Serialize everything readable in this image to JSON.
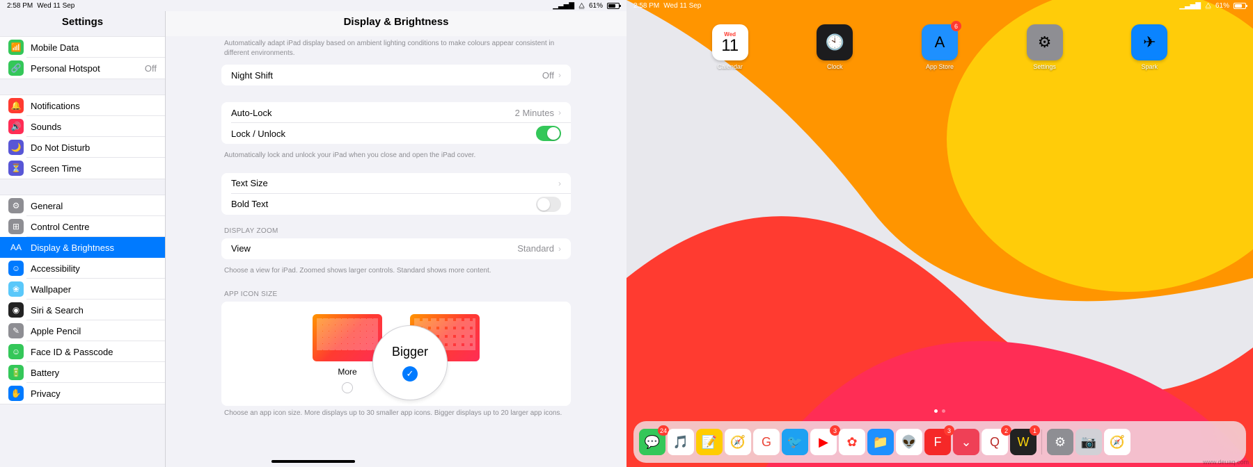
{
  "status": {
    "time": "2:58 PM",
    "date": "Wed 11 Sep",
    "battery": "61%"
  },
  "sidebar": {
    "title": "Settings",
    "g1": [
      {
        "label": "Mobile Data",
        "icon": "📶",
        "bg": "#34c759"
      },
      {
        "label": "Personal Hotspot",
        "icon": "🔗",
        "bg": "#34c759",
        "value": "Off"
      }
    ],
    "g2": [
      {
        "label": "Notifications",
        "icon": "🔔",
        "bg": "#ff3b30"
      },
      {
        "label": "Sounds",
        "icon": "🔊",
        "bg": "#ff2d55"
      },
      {
        "label": "Do Not Disturb",
        "icon": "🌙",
        "bg": "#5856d6"
      },
      {
        "label": "Screen Time",
        "icon": "⏳",
        "bg": "#5856d6"
      }
    ],
    "g3": [
      {
        "label": "General",
        "icon": "⚙︎",
        "bg": "#8e8e93"
      },
      {
        "label": "Control Centre",
        "icon": "⊞",
        "bg": "#8e8e93"
      },
      {
        "label": "Display & Brightness",
        "icon": "AA",
        "bg": "#007aff",
        "selected": true
      },
      {
        "label": "Accessibility",
        "icon": "☺",
        "bg": "#007aff"
      },
      {
        "label": "Wallpaper",
        "icon": "❀",
        "bg": "#5ac8fa"
      },
      {
        "label": "Siri & Search",
        "icon": "◉",
        "bg": "#222"
      },
      {
        "label": "Apple Pencil",
        "icon": "✎",
        "bg": "#8e8e93"
      },
      {
        "label": "Face ID & Passcode",
        "icon": "☺",
        "bg": "#34c759"
      },
      {
        "label": "Battery",
        "icon": "🔋",
        "bg": "#34c759"
      },
      {
        "label": "Privacy",
        "icon": "✋",
        "bg": "#007aff"
      }
    ]
  },
  "detail": {
    "title": "Display & Brightness",
    "caption1": "Automatically adapt iPad display based on ambient lighting conditions to make colours appear consistent in different environments.",
    "nightshift": {
      "label": "Night Shift",
      "value": "Off"
    },
    "autolock": {
      "label": "Auto-Lock",
      "value": "2 Minutes"
    },
    "lockunlock": {
      "label": "Lock / Unlock"
    },
    "caption2": "Automatically lock and unlock your iPad when you close and open the iPad cover.",
    "textsize": "Text Size",
    "boldtext": "Bold Text",
    "zoomheader": "DISPLAY ZOOM",
    "view": {
      "label": "View",
      "value": "Standard"
    },
    "caption3": "Choose a view for iPad. Zoomed shows larger controls. Standard shows more content.",
    "iconheader": "APP ICON SIZE",
    "more": "More",
    "bigger": "Bigger",
    "caption4": "Choose an app icon size. More displays up to 30 smaller app icons. Bigger displays up to 20 larger app icons."
  },
  "home": {
    "apps": [
      {
        "label": "Calendar",
        "type": "cal",
        "day": "11",
        "wd": "Wed"
      },
      {
        "label": "Clock",
        "bg": "#1c1c1e",
        "glyph": "🕙"
      },
      {
        "label": "App Store",
        "bg": "#1e90ff",
        "glyph": "A",
        "badge": "6"
      },
      {
        "label": "Settings",
        "bg": "#8e8e93",
        "glyph": "⚙︎"
      },
      {
        "label": "Spark",
        "bg": "#0a84ff",
        "glyph": "✈︎"
      }
    ],
    "dock": [
      {
        "bg": "#34c759",
        "glyph": "💬",
        "badge": "24"
      },
      {
        "bg": "#fff",
        "glyph": "🎵",
        "fg": "#ff2d55"
      },
      {
        "bg": "#ffcc00",
        "glyph": "📝"
      },
      {
        "bg": "#fff",
        "glyph": "🧭",
        "fg": "#1e90ff"
      },
      {
        "bg": "#fff",
        "glyph": "G",
        "fg": "#ea4335"
      },
      {
        "bg": "#1da1f2",
        "glyph": "🐦"
      },
      {
        "bg": "#fff",
        "glyph": "▶",
        "fg": "#ff0000",
        "badge": "3"
      },
      {
        "bg": "#fff",
        "glyph": "✿",
        "fg": "#ff3b30"
      },
      {
        "bg": "#1e90ff",
        "glyph": "📁"
      },
      {
        "bg": "#fff",
        "glyph": "👽",
        "fg": "#ff4500"
      },
      {
        "bg": "#f52828",
        "glyph": "F",
        "badge": "3"
      },
      {
        "bg": "#ef4056",
        "glyph": "⌄"
      },
      {
        "bg": "#fff",
        "glyph": "Q",
        "fg": "#b92b27",
        "badge": "2"
      },
      {
        "bg": "#222",
        "glyph": "W",
        "fg": "#ffd60a",
        "badge": "1"
      },
      {
        "sep": true
      },
      {
        "bg": "#8e8e93",
        "glyph": "⚙︎"
      },
      {
        "bg": "#d1d1d6",
        "glyph": "📷"
      },
      {
        "bg": "#fff",
        "glyph": "🧭",
        "fg": "#1e90ff"
      }
    ]
  },
  "watermark": "www.deuaq.com"
}
